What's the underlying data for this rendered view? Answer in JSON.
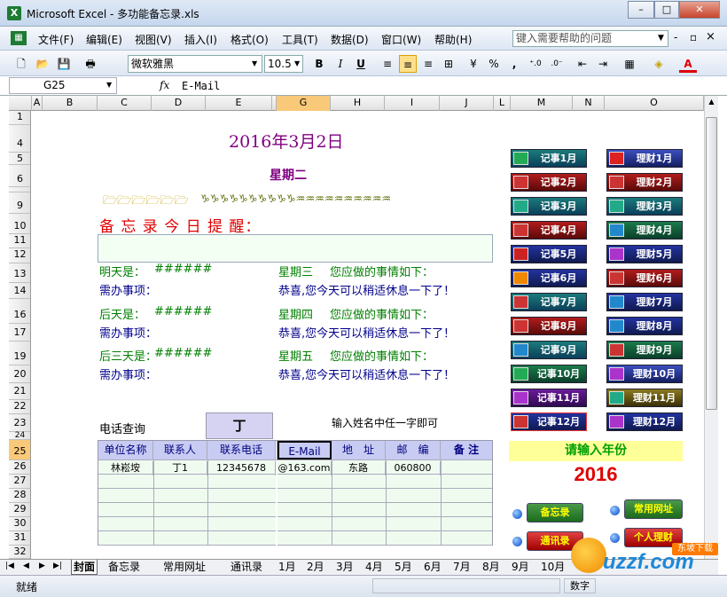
{
  "window": {
    "app": "Microsoft Excel",
    "title": "Microsoft Excel - 多功能备忘录.xls",
    "controls": [
      "–",
      "□",
      "✕"
    ]
  },
  "menu": {
    "items": [
      "文件(F)",
      "编辑(E)",
      "视图(V)",
      "插入(I)",
      "格式(O)",
      "工具(T)",
      "数据(D)",
      "窗口(W)",
      "帮助(H)"
    ],
    "help_placeholder": "键入需要帮助的问题",
    "doc_controls": [
      "-",
      "▫",
      "×"
    ]
  },
  "toolbar": {
    "font": "微软雅黑",
    "size": "10.5",
    "bold": "B",
    "italic": "I",
    "underline": "U",
    "percent": "%",
    "comma": ","
  },
  "formula": {
    "cell": "G25",
    "fx": "fx",
    "value": "E-Mail"
  },
  "columns": [
    "A",
    "B",
    "C",
    "D",
    "E",
    "F",
    "G",
    "H",
    "I",
    "J",
    "L",
    "M",
    "N",
    "O"
  ],
  "rows": [
    "1",
    "4",
    "5",
    "6",
    "",
    "9",
    "10",
    "11",
    "12",
    "13",
    "14",
    "16",
    "17",
    "19",
    "20",
    "21",
    "22",
    "23",
    "24",
    "25",
    "26",
    "27",
    "28",
    "29",
    "30",
    "31",
    "32"
  ],
  "sheet": {
    "date": "2016年3月2日",
    "weekday": "星期二",
    "deco_icons": "🗁🗁🗁🗁🗁🗁",
    "deco_signs": "♑♑♑♑♑♑♑♑♑♑♒♒♒♒♒♒♒♒♒♒",
    "reminder_title": "备 忘 录 今 日 提 醒：",
    "day_labels": [
      "明天是：",
      "后天是：",
      "后三天是："
    ],
    "day_values": [
      "######",
      "######",
      "######"
    ],
    "todo_label": "需办事项：",
    "weekday_notes": [
      "星期三",
      "星期四",
      "星期五"
    ],
    "note_suffix": "您应做的事情如下：",
    "relax_message": "恭喜,您今天可以稍适休息一下了！",
    "phone_query": "电话查询",
    "query_value": "丁",
    "query_hint": "输入姓名中任一字即可",
    "table_headers": [
      "单位名称",
      "联系人",
      "联系电话",
      "E-Mail",
      "地　址",
      "邮　编",
      "备 注"
    ],
    "table_row": [
      "林崧垵",
      "丁1",
      "12345678",
      "@163.com",
      "东路",
      "060800",
      ""
    ],
    "notes_buttons": [
      "记事1月",
      "记事2月",
      "记事3月",
      "记事4月",
      "记事5月",
      "记事6月",
      "记事7月",
      "记事8月",
      "记事9月",
      "记事10月",
      "记事11月",
      "记事12月"
    ],
    "finance_buttons": [
      "理财1月",
      "理财2月",
      "理财3月",
      "理财4月",
      "理财5月",
      "理财6月",
      "理财7月",
      "理财8月",
      "理财9月",
      "理财10月",
      "理财11月",
      "理财12月"
    ],
    "year_label": "请输入年份",
    "year_value": "2016",
    "bottom_buttons": [
      "备忘录",
      "常用网址",
      "通讯录",
      "个人理财"
    ]
  },
  "tabs": {
    "nav": [
      "|◀",
      "◀",
      "▶",
      "▶|"
    ],
    "items": [
      "封面",
      "备忘录",
      "常用网址",
      "通讯录",
      "1月",
      "2月",
      "3月",
      "4月",
      "5月",
      "6月",
      "7月",
      "8月",
      "9月",
      "10月"
    ]
  },
  "status": {
    "ready": "就绪",
    "mode": "数字"
  },
  "watermark": {
    "text": "uzzf.com",
    "badge": "东坡下载"
  },
  "colors": {
    "purple": "#800080",
    "red": "#e00000",
    "green": "#008000",
    "navy": "#00008b",
    "table_header": "#c8ccf2",
    "year_bg": "#ffff99"
  }
}
